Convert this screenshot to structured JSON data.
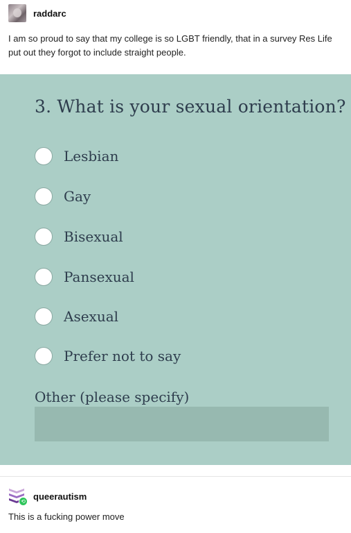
{
  "post": {
    "username": "raddarc",
    "text": "I am so proud to say that my college is so LGBT friendly, that in a survey Res Life put out they forgot to include straight people."
  },
  "survey": {
    "question": "3. What is your sexual orientation?",
    "options": [
      "Lesbian",
      "Gay",
      "Bisexual",
      "Pansexual",
      "Asexual",
      "Prefer not to say"
    ],
    "other_label": "Other (please specify)",
    "other_value": ""
  },
  "reply": {
    "username": "queerautism",
    "text": "This is a fucking power move"
  },
  "colors": {
    "survey_background": "#abcec6",
    "survey_text": "#2e3d4d",
    "other_input_background": "#97b9b0",
    "reblog_badge": "#2ec55b"
  },
  "icons": {
    "reblog_badge": "reblog-icon"
  }
}
